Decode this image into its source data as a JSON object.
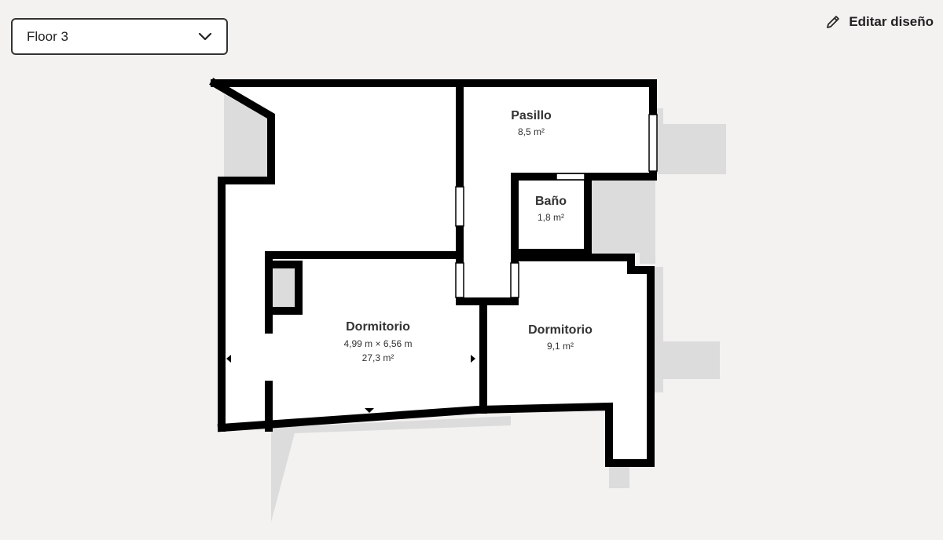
{
  "floor_selector": {
    "value": "Floor 3"
  },
  "header": {
    "edit_label": "Editar diseño"
  },
  "rooms": {
    "pasillo": {
      "name": "Pasillo",
      "area": "8,5 m²"
    },
    "bano": {
      "name": "Baño",
      "area": "1,8 m²"
    },
    "dormitorio_main": {
      "name": "Dormitorio",
      "dimensions": "4,99 m × 6,56 m",
      "area": "27,3 m²"
    },
    "dormitorio_small": {
      "name": "Dormitorio",
      "area": "9,1 m²"
    }
  },
  "colors": {
    "background": "#f4f2f1",
    "wall": "#000000",
    "shadow": "#dcdcdc",
    "room_fill": "#ffffff"
  }
}
